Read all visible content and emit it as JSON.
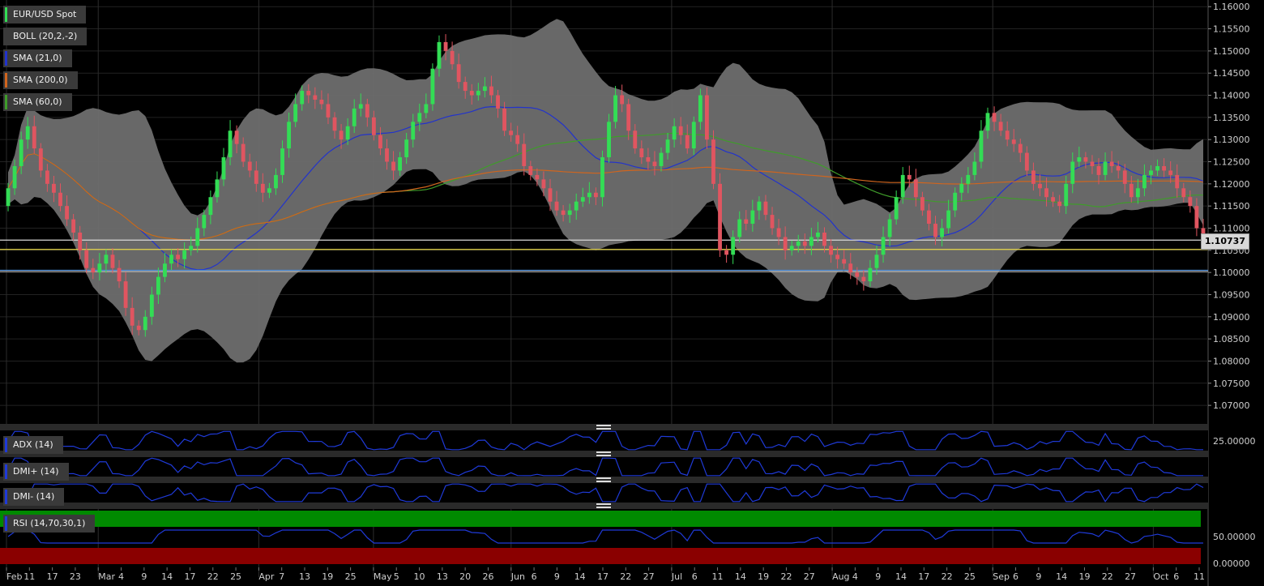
{
  "chart_data": {
    "type": "candlestick",
    "symbol": "EUR/USD Spot",
    "indicators": [
      {
        "name": "BOLL (20,2,-2)",
        "color": "#808080"
      },
      {
        "name": "SMA (21,0)",
        "color": "#2233cc"
      },
      {
        "name": "SMA (200,0)",
        "color": "#d0651e"
      },
      {
        "name": "SMA (60,0)",
        "color": "#3f9c2a"
      }
    ],
    "last_price": "1.10737",
    "ylim": [
      1.066,
      1.1615
    ],
    "y_ticks": [
      "1.16000",
      "1.15500",
      "1.15000",
      "1.14500",
      "1.14000",
      "1.13500",
      "1.13000",
      "1.12500",
      "1.12000",
      "1.11500",
      "1.11000",
      "1.10500",
      "1.10000",
      "1.09500",
      "1.09000",
      "1.08500",
      "1.08000",
      "1.07500",
      "1.07000"
    ],
    "x_tick_labels": [
      "Feb",
      "11",
      "17",
      "23",
      "Mar",
      "4",
      "9",
      "14",
      "17",
      "22",
      "25",
      "Apr",
      "7",
      "13",
      "19",
      "25",
      "May",
      "5",
      "10",
      "13",
      "20",
      "26",
      "Jun",
      "6",
      "9",
      "14",
      "17",
      "22",
      "27",
      "Jul",
      "6",
      "11",
      "14",
      "19",
      "22",
      "27",
      "Aug",
      "4",
      "9",
      "14",
      "17",
      "22",
      "25",
      "Sep",
      "6",
      "9",
      "14",
      "19",
      "22",
      "27",
      "Oct",
      "6",
      "11"
    ],
    "month_labels": [
      "Feb",
      "Mar",
      "Apr",
      "May",
      "Jun",
      "Jul",
      "Aug",
      "Sep",
      "Oct"
    ],
    "horizontal_lines": [
      {
        "value": 1.1073,
        "color": "#d8d8d8"
      },
      {
        "value": 1.1052,
        "color": "#e8d84a"
      },
      {
        "value": 1.1005,
        "color": "#4a8cd8"
      },
      {
        "value": 1.1002,
        "color": "#c0c0c0"
      }
    ],
    "close": [
      1.119,
      1.124,
      1.13,
      1.133,
      1.128,
      1.123,
      1.12,
      1.118,
      1.115,
      1.112,
      1.109,
      1.105,
      1.101,
      1.1,
      1.102,
      1.104,
      1.101,
      1.098,
      1.092,
      1.088,
      1.087,
      1.09,
      1.095,
      1.099,
      1.102,
      1.104,
      1.103,
      1.105,
      1.106,
      1.11,
      1.113,
      1.117,
      1.121,
      1.126,
      1.132,
      1.129,
      1.125,
      1.123,
      1.12,
      1.118,
      1.119,
      1.122,
      1.128,
      1.134,
      1.138,
      1.141,
      1.14,
      1.139,
      1.138,
      1.135,
      1.132,
      1.13,
      1.133,
      1.137,
      1.138,
      1.135,
      1.131,
      1.128,
      1.125,
      1.123,
      1.126,
      1.13,
      1.134,
      1.136,
      1.138,
      1.146,
      1.152,
      1.15,
      1.147,
      1.143,
      1.141,
      1.14,
      1.141,
      1.142,
      1.14,
      1.137,
      1.132,
      1.131,
      1.129,
      1.124,
      1.122,
      1.121,
      1.119,
      1.116,
      1.114,
      1.113,
      1.114,
      1.116,
      1.117,
      1.118,
      1.117,
      1.126,
      1.134,
      1.14,
      1.138,
      1.132,
      1.128,
      1.126,
      1.125,
      1.124,
      1.127,
      1.13,
      1.133,
      1.131,
      1.128,
      1.134,
      1.14,
      1.13,
      1.12,
      1.105,
      1.104,
      1.108,
      1.112,
      1.111,
      1.114,
      1.116,
      1.113,
      1.11,
      1.108,
      1.105,
      1.106,
      1.107,
      1.106,
      1.108,
      1.109,
      1.106,
      1.104,
      1.103,
      1.102,
      1.1,
      1.099,
      1.098,
      1.101,
      1.104,
      1.108,
      1.112,
      1.117,
      1.122,
      1.121,
      1.117,
      1.114,
      1.111,
      1.108,
      1.11,
      1.114,
      1.118,
      1.12,
      1.122,
      1.125,
      1.132,
      1.136,
      1.134,
      1.132,
      1.13,
      1.129,
      1.127,
      1.123,
      1.12,
      1.119,
      1.117,
      1.116,
      1.115,
      1.12,
      1.125,
      1.126,
      1.125,
      1.124,
      1.122,
      1.125,
      1.124,
      1.123,
      1.12,
      1.117,
      1.119,
      1.122,
      1.123,
      1.124,
      1.123,
      1.122,
      1.119,
      1.117,
      1.115,
      1.11,
      1.1074
    ],
    "open": [
      1.115,
      1.119,
      1.124,
      1.13,
      1.133,
      1.128,
      1.123,
      1.12,
      1.118,
      1.115,
      1.112,
      1.109,
      1.105,
      1.101,
      1.1,
      1.102,
      1.104,
      1.101,
      1.098,
      1.092,
      1.088,
      1.087,
      1.09,
      1.095,
      1.099,
      1.102,
      1.104,
      1.103,
      1.105,
      1.106,
      1.11,
      1.113,
      1.117,
      1.121,
      1.126,
      1.132,
      1.129,
      1.125,
      1.123,
      1.12,
      1.118,
      1.119,
      1.122,
      1.128,
      1.134,
      1.138,
      1.141,
      1.14,
      1.139,
      1.138,
      1.135,
      1.132,
      1.13,
      1.133,
      1.137,
      1.138,
      1.135,
      1.131,
      1.128,
      1.125,
      1.123,
      1.126,
      1.13,
      1.134,
      1.136,
      1.138,
      1.146,
      1.152,
      1.15,
      1.147,
      1.143,
      1.141,
      1.14,
      1.141,
      1.142,
      1.14,
      1.137,
      1.132,
      1.131,
      1.129,
      1.124,
      1.122,
      1.121,
      1.119,
      1.116,
      1.114,
      1.113,
      1.114,
      1.116,
      1.117,
      1.118,
      1.117,
      1.126,
      1.134,
      1.14,
      1.138,
      1.132,
      1.128,
      1.126,
      1.125,
      1.124,
      1.127,
      1.13,
      1.133,
      1.131,
      1.128,
      1.134,
      1.14,
      1.13,
      1.12,
      1.105,
      1.104,
      1.108,
      1.112,
      1.111,
      1.114,
      1.116,
      1.113,
      1.11,
      1.108,
      1.105,
      1.106,
      1.107,
      1.106,
      1.108,
      1.109,
      1.106,
      1.104,
      1.103,
      1.102,
      1.1,
      1.099,
      1.098,
      1.101,
      1.104,
      1.108,
      1.112,
      1.117,
      1.122,
      1.121,
      1.117,
      1.114,
      1.111,
      1.108,
      1.11,
      1.114,
      1.118,
      1.12,
      1.122,
      1.125,
      1.132,
      1.136,
      1.134,
      1.132,
      1.13,
      1.129,
      1.127,
      1.123,
      1.12,
      1.119,
      1.117,
      1.116,
      1.115,
      1.12,
      1.125,
      1.126,
      1.125,
      1.124,
      1.122,
      1.125,
      1.124,
      1.123,
      1.12,
      1.117,
      1.119,
      1.122,
      1.123,
      1.124,
      1.123,
      1.122,
      1.119,
      1.117,
      1.115,
      1.11
    ],
    "sub_panels": [
      {
        "name": "ADX (14)",
        "ticks": [
          "25.00000"
        ]
      },
      {
        "name": "DMI+ (14)",
        "ticks": []
      },
      {
        "name": "DMI- (14)",
        "ticks": []
      },
      {
        "name": "RSI (14,70,30,1)",
        "ticks": [
          "50.00000",
          "0.00000"
        ]
      }
    ]
  },
  "colors": {
    "up": "#33dd55",
    "down": "#e05560",
    "band": "#6e6e6e",
    "rsi_overbought": "#008a00",
    "rsi_oversold": "#8a0000",
    "indicator_line": "#1f3ad8"
  }
}
